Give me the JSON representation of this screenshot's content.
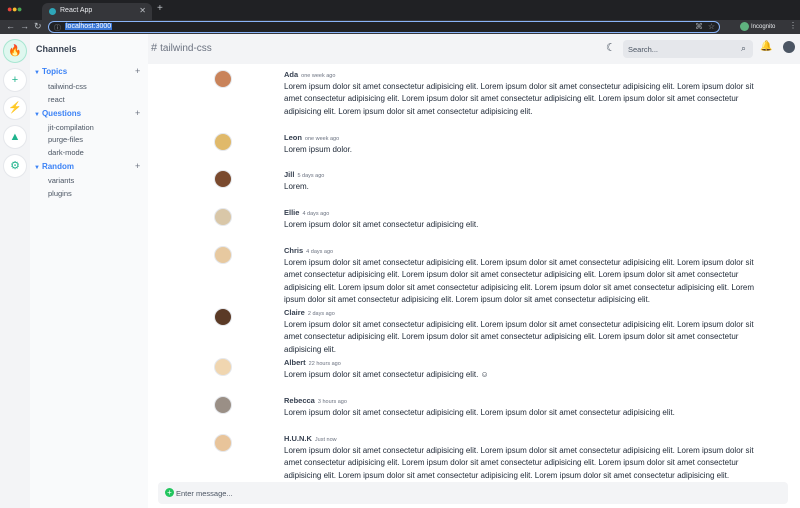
{
  "browser": {
    "tab_title": "React App",
    "tab_close": "✕",
    "new_tab": "+",
    "url": "localhost:3000",
    "incognito_label": "Incognito"
  },
  "rail": {
    "items": [
      {
        "icon": "flame-icon",
        "glyph": "🔥"
      },
      {
        "icon": "plus-icon",
        "glyph": "+"
      },
      {
        "icon": "bolt-icon",
        "glyph": "⚡"
      },
      {
        "icon": "poop-icon",
        "glyph": "▲"
      },
      {
        "icon": "gear-icon",
        "glyph": "⚙"
      }
    ],
    "accent": "#1db38c"
  },
  "sidebar": {
    "title": "Channels",
    "groups": [
      {
        "label": "Topics",
        "channels": [
          "tailwind-css",
          "react"
        ]
      },
      {
        "label": "Questions",
        "channels": [
          "jit-compilation",
          "purge-files",
          "dark-mode"
        ]
      },
      {
        "label": "Random",
        "channels": [
          "variants",
          "plugins"
        ]
      }
    ],
    "group_color": "#3b82f6"
  },
  "header": {
    "channel": "tailwind-css",
    "search_placeholder": "Search..."
  },
  "messages": [
    {
      "author": "Ada",
      "time": "one week ago",
      "text": "Lorem ipsum dolor sit amet consectetur adipisicing elit. Lorem ipsum dolor sit amet consectetur adipisicing elit. Lorem ipsum dolor sit amet consectetur adipisicing elit. Lorem ipsum dolor sit amet consectetur adipisicing elit. Lorem ipsum dolor sit amet consectetur adipisicing elit. Lorem ipsum dolor sit amet consectetur adipisicing elit."
    },
    {
      "author": "Leon",
      "time": "one week ago",
      "text": "Lorem ipsum dolor."
    },
    {
      "author": "Jill",
      "time": "5 days ago",
      "text": "Lorem."
    },
    {
      "author": "Ellie",
      "time": "4 days ago",
      "text": "Lorem ipsum dolor sit amet consectetur adipisicing elit."
    },
    {
      "author": "Chris",
      "time": "4 days ago",
      "text": "Lorem ipsum dolor sit amet consectetur adipisicing elit. Lorem ipsum dolor sit amet consectetur adipisicing elit. Lorem ipsum dolor sit amet consectetur adipisicing elit. Lorem ipsum dolor sit amet consectetur adipisicing elit. Lorem ipsum dolor sit amet consectetur adipisicing elit. Lorem ipsum dolor sit amet consectetur adipisicing elit. Lorem ipsum dolor sit amet consectetur adipisicing elit. Lorem ipsum dolor sit amet consectetur adipisicing elit. Lorem ipsum dolor sit amet consectetur adipisicing elit."
    },
    {
      "author": "Claire",
      "time": "2 days ago",
      "text": "Lorem ipsum dolor sit amet consectetur adipisicing elit. Lorem ipsum dolor sit amet consectetur adipisicing elit. Lorem ipsum dolor sit amet consectetur adipisicing elit. Lorem ipsum dolor sit amet consectetur adipisicing elit. Lorem ipsum dolor sit amet consectetur adipisicing elit."
    },
    {
      "author": "Albert",
      "time": "22 hours ago",
      "text": "Lorem ipsum dolor sit amet consectetur adipisicing elit. ☺"
    },
    {
      "author": "Rebecca",
      "time": "3 hours ago",
      "text": "Lorem ipsum dolor sit amet consectetur adipisicing elit. Lorem ipsum dolor sit amet consectetur adipisicing elit."
    },
    {
      "author": "H.U.N.K",
      "time": "Just now",
      "text": "Lorem ipsum dolor sit amet consectetur adipisicing elit. Lorem ipsum dolor sit amet consectetur adipisicing elit. Lorem ipsum dolor sit amet consectetur adipisicing elit. Lorem ipsum dolor sit amet consectetur adipisicing elit. Lorem ipsum dolor sit amet consectetur adipisicing elit. Lorem ipsum dolor sit amet consectetur adipisicing elit. Lorem ipsum dolor sit amet consectetur adipisicing elit."
    }
  ],
  "composer": {
    "placeholder": "Enter message..."
  }
}
